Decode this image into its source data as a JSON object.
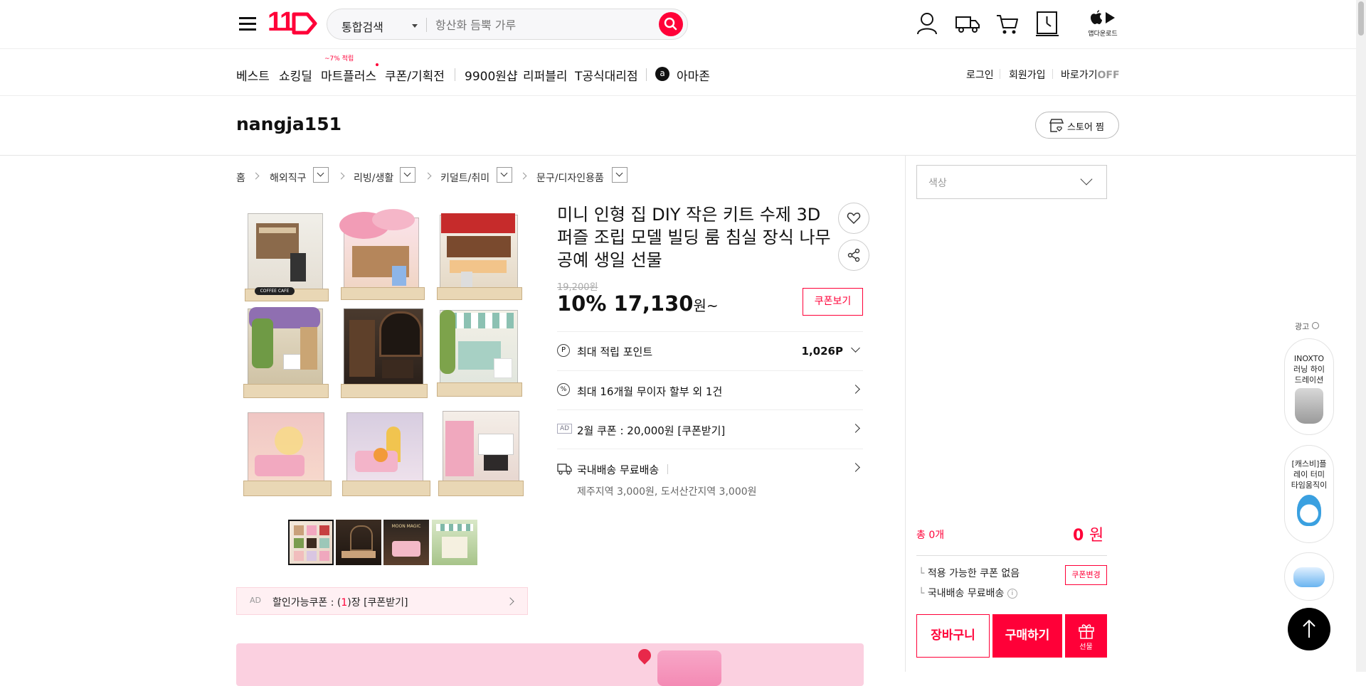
{
  "header": {
    "logo_text": "11",
    "search_scope": "통합검색",
    "search_placeholder": "항산화 듬뿍 가루",
    "app_download_label": "앱다운로드"
  },
  "nav": {
    "items": [
      "베스트",
      "쇼킹딜",
      "마트플러스",
      "쿠폰/기획전",
      "9900원샵",
      "리퍼블리",
      "T공식대리점",
      "아마존"
    ],
    "mart_badge": "~7% 적립",
    "amazon_icon": "a",
    "util": {
      "login": "로그인",
      "signup": "회원가입",
      "shortcut": "바로가기",
      "shortcut_state": "OFF"
    }
  },
  "store": {
    "name": "nangja151",
    "fav_label": "스토어 찜"
  },
  "breadcrumb": [
    "홈",
    "해외직구",
    "리빙/생활",
    "키덜트/취미",
    "문구/디자인용품"
  ],
  "product": {
    "title": "미니 인형 집 DIY 작은 키트 수제 3D 퍼즐 조립 모델 빌딩 룸 침실 장식 나무 공예 생일 선물",
    "original_price": "19,200원",
    "discount": "10%",
    "price": "17,130",
    "price_unit": "원~",
    "coupon_view_label": "쿠폰보기",
    "rows": {
      "points_label": "최대 적립 포인트",
      "points_value": "1,026P",
      "points_icon": "P",
      "installment": "최대 16개월 무이자 할부 외 1건",
      "installment_icon": "%",
      "ad_badge": "AD",
      "coupon_ad": "2월 쿠폰 : 20,000원 [쿠폰받기]",
      "shipping": "국내배송 무료배송",
      "shipping_extra": "제주지역 3,000원, 도서산간지역 3,000원"
    },
    "image_labels": {
      "cafe_sign": "COFFEE CAFE",
      "thumb_label": "MOON MAGIC"
    },
    "ad_coupon": {
      "badge": "AD",
      "prefix": "할인가능쿠폰 : (",
      "count": "1",
      "suffix": ")장 [쿠폰받기]"
    }
  },
  "buy_panel": {
    "color_placeholder": "색상",
    "total_label": "총 0개",
    "total_amount": "0",
    "total_unit": "원",
    "coupon_none": "적용 가능한 쿠폰 없음",
    "coupon_change": "쿠폰변경",
    "shipping_free": "국내배송 무료배송",
    "cart": "장바구니",
    "buy": "구매하기",
    "gift": "선물"
  },
  "side_ads": {
    "label": "광고",
    "items": [
      "INOXTO 러닝 하이드레이션",
      "[캐스비]플레이 터미 타임움직이"
    ]
  },
  "colors": {
    "brand": "#ff0038",
    "text": "#111111",
    "muted": "#999999"
  }
}
